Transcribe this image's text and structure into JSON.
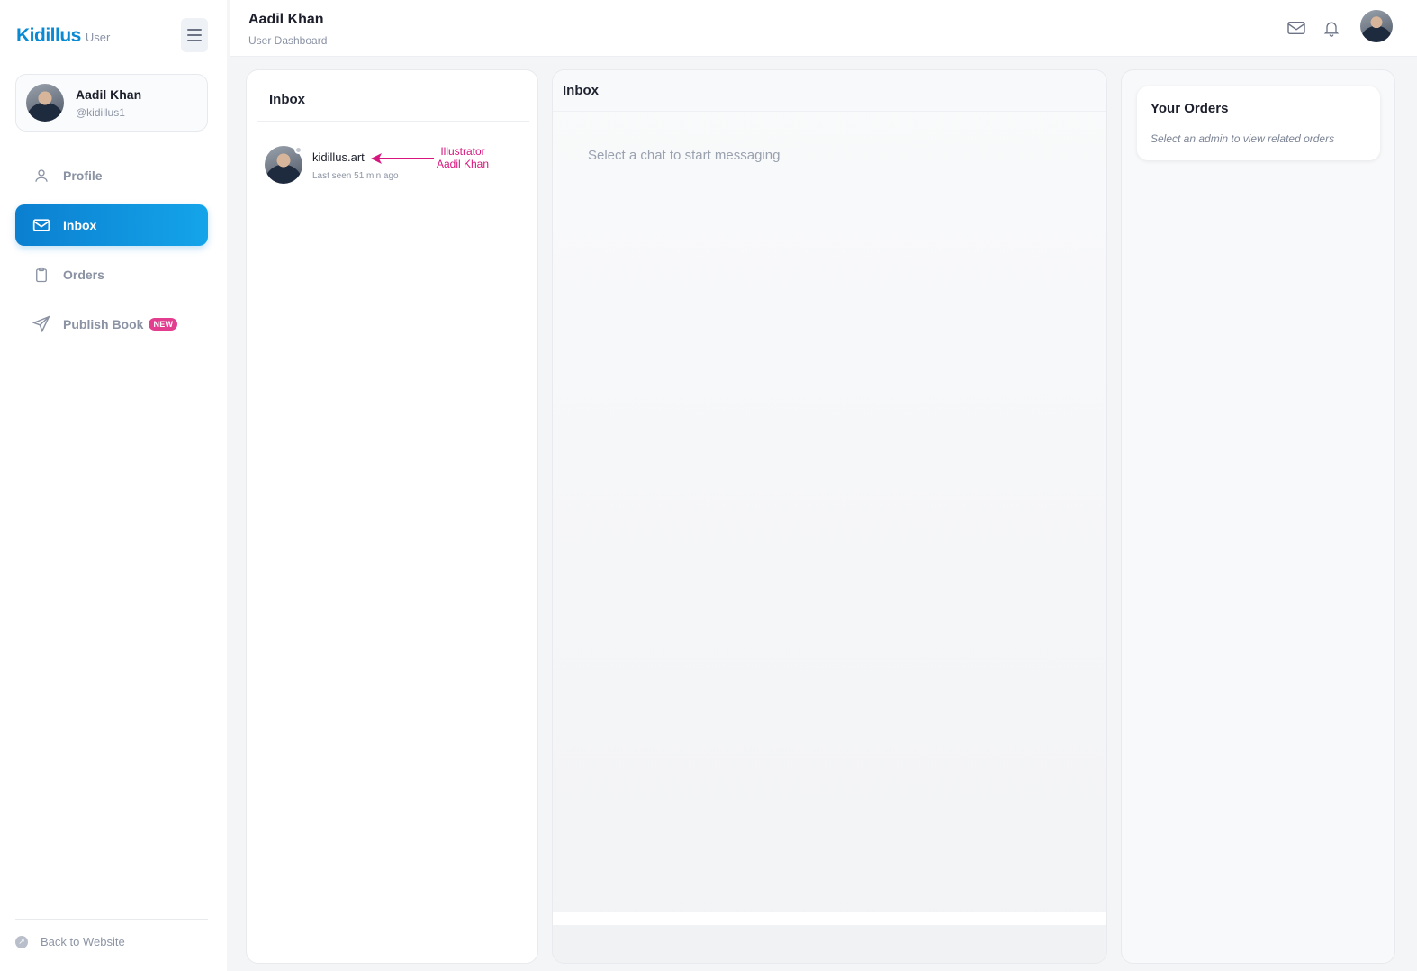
{
  "brand": {
    "name": "Kidillus",
    "suffix": "User"
  },
  "user": {
    "name": "Aadil Khan",
    "handle": "@kidillus1"
  },
  "nav": [
    {
      "label": "Profile",
      "icon": "user-icon",
      "active": false
    },
    {
      "label": "Inbox",
      "icon": "mail-icon",
      "active": true
    },
    {
      "label": "Orders",
      "icon": "clipboard-icon",
      "active": false
    },
    {
      "label": "Publish Book",
      "icon": "send-icon",
      "active": false,
      "badge": "NEW"
    }
  ],
  "back_link": "Back to Website",
  "header": {
    "title": "Aadil Khan",
    "subtitle": "User Dashboard"
  },
  "inbox_list": {
    "title": "Inbox",
    "chats": [
      {
        "name": "kidillus.art",
        "last_seen": "Last seen 51 min ago"
      }
    ]
  },
  "annotation": {
    "line1": "Illustrator",
    "line2": "Aadil Khan",
    "color": "#d6157e"
  },
  "chat_panel": {
    "title": "Inbox",
    "placeholder": "Select a chat to start messaging"
  },
  "orders_panel": {
    "title": "Your Orders",
    "subtitle": "Select an admin to view related orders"
  },
  "colors": {
    "accent": "#0b8ad3",
    "badge": "#e33d8f"
  }
}
